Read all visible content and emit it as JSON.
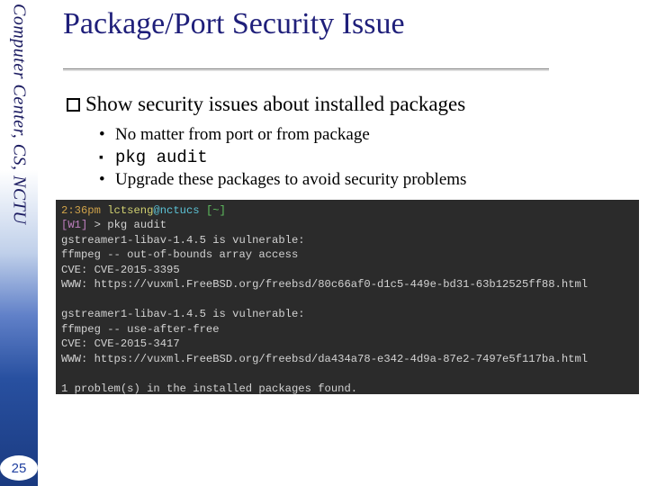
{
  "sidebar": {
    "org_text": "Computer Center, CS, NCTU",
    "page_number": "25"
  },
  "title": "Package/Port Security Issue",
  "main_bullet": "Show security issues about installed packages",
  "sub_bullets": {
    "b1": "No matter from port or from package",
    "b2": "pkg audit",
    "b3": "Upgrade these packages to avoid security problems"
  },
  "terminal": {
    "time": "2:36pm",
    "user": "lctseng",
    "host": "@nctucs",
    "path": "[~]",
    "prompt_indicator": "[W1]",
    "prompt_symbol": ">",
    "command": "pkg audit",
    "line1": "gstreamer1-libav-1.4.5 is vulnerable:",
    "line2": "ffmpeg -- out-of-bounds array access",
    "line3": "CVE: CVE-2015-3395",
    "line4": "WWW: https://vuxml.FreeBSD.org/freebsd/80c66af0-d1c5-449e-bd31-63b12525ff88.html",
    "line5": "gstreamer1-libav-1.4.5 is vulnerable:",
    "line6": "ffmpeg -- use-after-free",
    "line7": "CVE: CVE-2015-3417",
    "line8": "WWW: https://vuxml.FreeBSD.org/freebsd/da434a78-e342-4d9a-87e2-7497e5f117ba.html",
    "line9": "1 problem(s) in the installed packages found."
  }
}
